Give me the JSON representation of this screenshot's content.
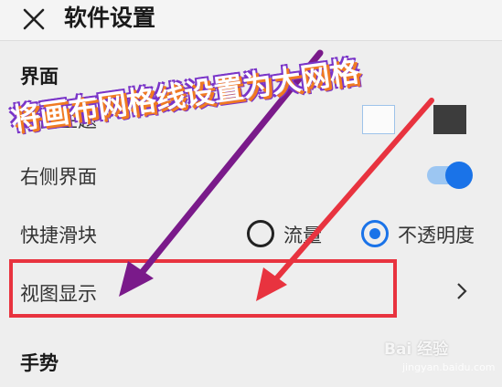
{
  "header": {
    "title": "软件设置",
    "close_icon": "close-icon"
  },
  "interface_section": {
    "title": "界面",
    "theme_label": "界面主题",
    "right_panel_label": "右侧界面",
    "right_panel_enabled": true,
    "quick_slider_label": "快捷滑块",
    "quick_slider_options": [
      {
        "label": "流量",
        "selected": false
      },
      {
        "label": "不透明度",
        "selected": true
      }
    ],
    "view_display_label": "视图显示"
  },
  "gesture_section": {
    "title": "手势"
  },
  "overlay": {
    "banner_text": "将画布网格线设置为大网格",
    "arrow_colors": [
      "#7a1a8a",
      "#e8333f"
    ],
    "box_color": "#e8333f"
  },
  "watermark": {
    "text": "Bai 经验",
    "sub": "jingyan.baidu.com"
  },
  "colors": {
    "accent": "#1a73e8",
    "background": "#eeeeee"
  }
}
